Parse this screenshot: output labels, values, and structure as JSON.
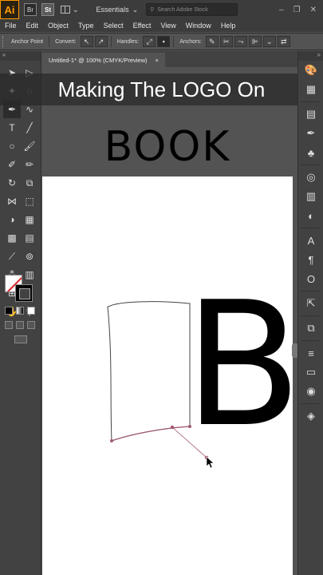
{
  "app": {
    "logo": "Ai",
    "br_icon": "Br",
    "st_icon": "St",
    "workspace": "Essentials",
    "stock_search_placeholder": "Search Adobe Stock",
    "win_minimize": "–",
    "win_restore": "❐",
    "win_close": "✕"
  },
  "menu": [
    "File",
    "Edit",
    "Object",
    "Type",
    "Select",
    "Effect",
    "View",
    "Window",
    "Help"
  ],
  "control_bar": {
    "anchor_point": "Anchor Point",
    "convert": "Convert:",
    "handles": "Handles:",
    "anchors": "Anchors:"
  },
  "document": {
    "tab_title": "Untitled-1* @ 100% (CMYK/Preview)",
    "tab_close": "×"
  },
  "caption": "Making The LOGO On",
  "artwork": {
    "heading": "BOOK",
    "letter": "B"
  },
  "colors": {
    "ui_dark": "#3c3c3c",
    "ui_mid": "#535353",
    "accent_ai": "#ff9a00",
    "path_selected": "#a05a6e"
  }
}
